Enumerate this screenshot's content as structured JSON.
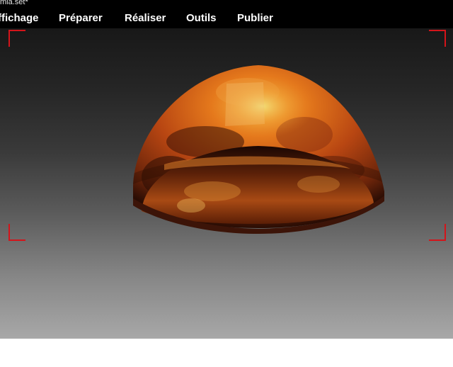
{
  "window": {
    "title": "mia.set*"
  },
  "menu": {
    "items": [
      {
        "label": "ffichage"
      },
      {
        "label": "Préparer"
      },
      {
        "label": "Réaliser"
      },
      {
        "label": "Outils"
      },
      {
        "label": "Publier"
      }
    ]
  },
  "viewport": {
    "background_top": "#181818",
    "background_bottom": "#a8a8a8",
    "frame_marker_color": "#d4141a",
    "model": "textured-dome"
  }
}
